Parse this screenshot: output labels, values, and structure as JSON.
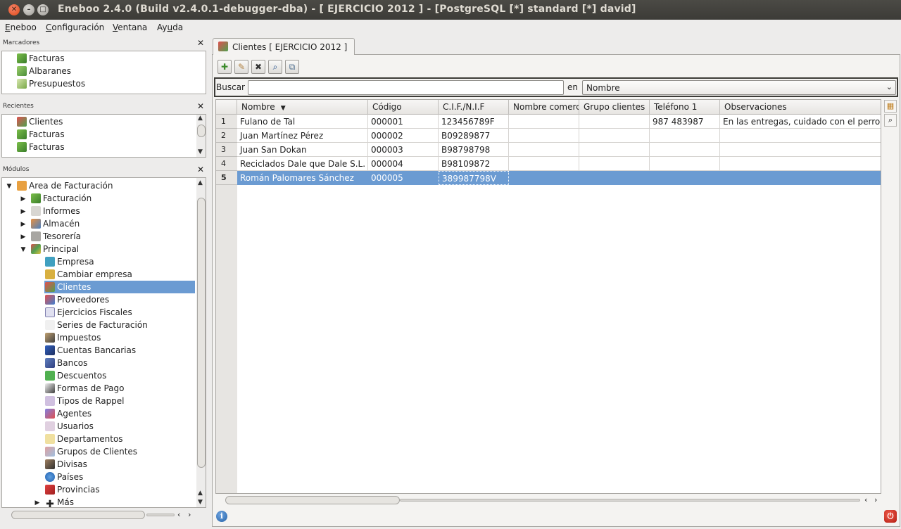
{
  "window": {
    "title": "Eneboo 2.4.0 (Build v2.4.0.1-debugger-dba)  - [ EJERCICIO 2012 ] - [PostgreSQL [*] standard [*] david]"
  },
  "menubar": {
    "items": [
      {
        "pre": "",
        "u": "E",
        "post": "neboo"
      },
      {
        "pre": "",
        "u": "C",
        "post": "onfiguración"
      },
      {
        "pre": "",
        "u": "V",
        "post": "entana"
      },
      {
        "pre": "Ay",
        "u": "u",
        "post": "da"
      }
    ]
  },
  "marcadores": {
    "title": "Marcadores",
    "items": [
      "Facturas",
      "Albaranes",
      "Presupuestos"
    ]
  },
  "recientes": {
    "title": "Recientes",
    "items": [
      "Clientes",
      "Facturas",
      "Facturas"
    ]
  },
  "modulos": {
    "title": "Módulos",
    "root": "Area de Facturación",
    "groups": [
      "Facturación",
      "Informes",
      "Almacén",
      "Tesorería",
      "Principal"
    ],
    "principal_items": [
      "Empresa",
      "Cambiar empresa",
      "Clientes",
      "Proveedores",
      "Ejercicios Fiscales",
      "Series de Facturación",
      "Impuestos",
      "Cuentas Bancarias",
      "Bancos",
      "Descuentos",
      "Formas de Pago",
      "Tipos de Rappel",
      "Agentes",
      "Usuarios",
      "Departamentos",
      "Grupos de Clientes",
      "Divisas",
      "Países",
      "Provincias"
    ],
    "more": "Más",
    "selected": "Clientes"
  },
  "tab": {
    "label": "Clientes [ EJERCICIO 2012 ]"
  },
  "search": {
    "label": "Buscar",
    "value": "",
    "en_label": "en",
    "field": "Nombre"
  },
  "table": {
    "columns": [
      "Nombre",
      "Código",
      "C.I.F./N.I.F",
      "Nombre comerc",
      "Grupo clientes",
      "Teléfono 1",
      "Observaciones"
    ],
    "rows": [
      {
        "n": "1",
        "cells": [
          "Fulano de Tal",
          "000001",
          "123456789F",
          "",
          "",
          "987 483987",
          "En las entregas, cuidado con el perro..."
        ]
      },
      {
        "n": "2",
        "cells": [
          "Juan Martínez Pérez",
          "000002",
          "B09289877",
          "",
          "",
          "",
          ""
        ]
      },
      {
        "n": "3",
        "cells": [
          "Juan San Dokan",
          "000003",
          "B98798798",
          "",
          "",
          "",
          ""
        ]
      },
      {
        "n": "4",
        "cells": [
          "Reciclados Dale que Dale S.L.",
          "000004",
          "B98109872",
          "",
          "",
          "",
          ""
        ]
      },
      {
        "n": "5",
        "cells": [
          "Román Palomares Sánchez",
          "000005",
          "389987798V",
          "",
          "",
          "",
          ""
        ]
      }
    ],
    "selected_row": 5
  },
  "colors": {
    "selection": "#6b9bd2",
    "titlebar": "#3c3b37",
    "close_button": "#df4a16"
  }
}
